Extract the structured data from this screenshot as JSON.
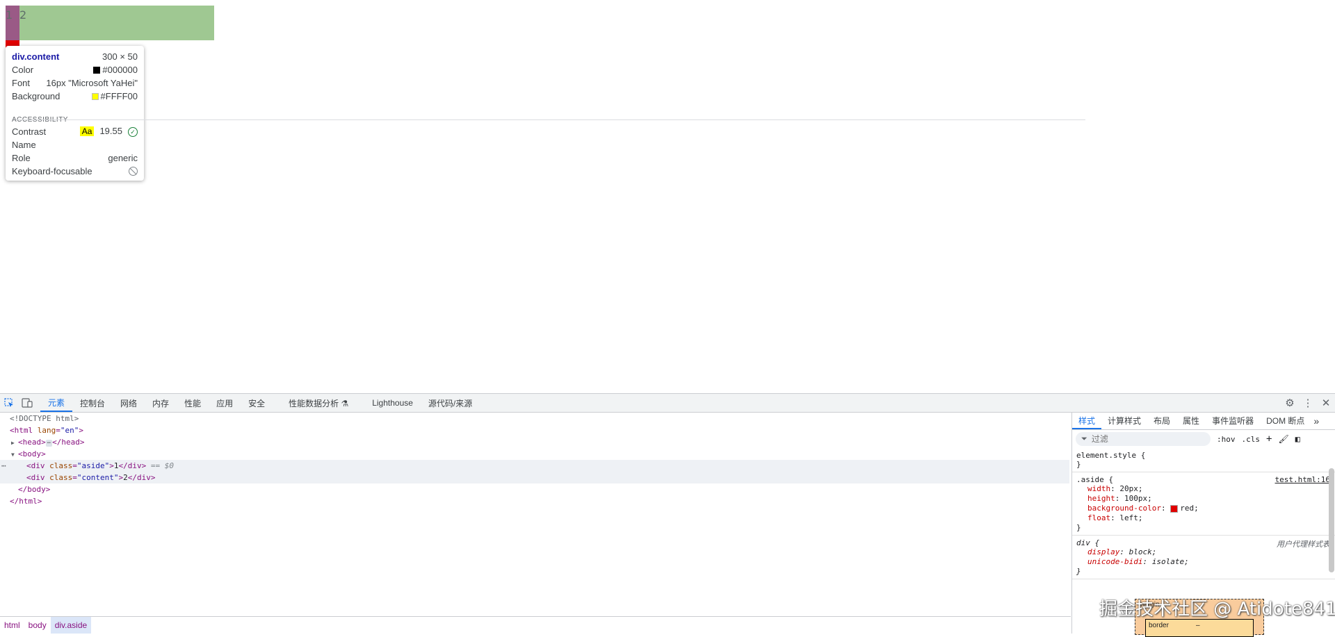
{
  "page": {
    "aside_text": "1",
    "content_text": "2"
  },
  "tooltip": {
    "title": "div.content",
    "size": "300 × 50",
    "color_label": "Color",
    "color_value": "#000000",
    "font_label": "Font",
    "font_value": "16px \"Microsoft YaHei\"",
    "background_label": "Background",
    "background_value": "#FFFF00",
    "section": "ACCESSIBILITY",
    "contrast_label": "Contrast",
    "contrast_aa": "Aa",
    "contrast_value": "19.55",
    "name_label": "Name",
    "role_label": "Role",
    "role_value": "generic",
    "keyboard_label": "Keyboard-focusable",
    "colors": {
      "color_swatch": "#000000",
      "bg_swatch": "#FFFF00"
    }
  },
  "devtools": {
    "tabs": [
      "元素",
      "控制台",
      "网络",
      "内存",
      "性能",
      "应用",
      "安全",
      "性能数据分析 ⚗",
      "Lighthouse",
      "源代码/来源"
    ],
    "active_tab": "元素",
    "dom": {
      "doctype": "<!DOCTYPE html>",
      "html_open_tag": "html",
      "html_attr": "lang",
      "html_attr_val": "\"en\"",
      "head_open": "<head>",
      "head_close": "</head>",
      "ellipsis": "⋯",
      "body_open": "<body>",
      "aside_tag_open": "<div",
      "aside_attr": "class",
      "aside_val": "\"aside\"",
      "aside_text": "1",
      "div_close": "</div>",
      "selected_marker": "== $0",
      "content_tag_open": "<div",
      "content_attr": "class",
      "content_val": "\"content\"",
      "content_text": "2",
      "body_close": "</body>",
      "html_close": "</html>",
      "row_dots": "⋯"
    },
    "breadcrumb": [
      "html",
      "body",
      "div.aside"
    ],
    "styles": {
      "tabs": [
        "样式",
        "计算样式",
        "布局",
        "属性",
        "事件监听器",
        "DOM 断点"
      ],
      "active_tab": "样式",
      "more": "»",
      "filter_placeholder": "过滤",
      "hov": ":hov",
      ".cls": ".cls",
      "element_style": "element.style {",
      "close_brace": "}",
      "aside_rule": {
        "selector": ".aside {",
        "source": "test.html:16",
        "props": [
          {
            "name": "width",
            "value": "20px;"
          },
          {
            "name": "height",
            "value": "100px;"
          },
          {
            "name": "background-color",
            "value": "red;"
          },
          {
            "name": "float",
            "value": "left;"
          }
        ]
      },
      "div_rule": {
        "selector": "div {",
        "source": "用户代理样式表",
        "props": [
          {
            "name": "display",
            "value": "block;"
          },
          {
            "name": "unicode-bidi",
            "value": "isolate;"
          }
        ]
      },
      "boxmodel": {
        "margin_label": "margin",
        "border_label": "border",
        "dash": "–"
      }
    }
  },
  "watermark": "掘金技术社区 @ Atidote841"
}
